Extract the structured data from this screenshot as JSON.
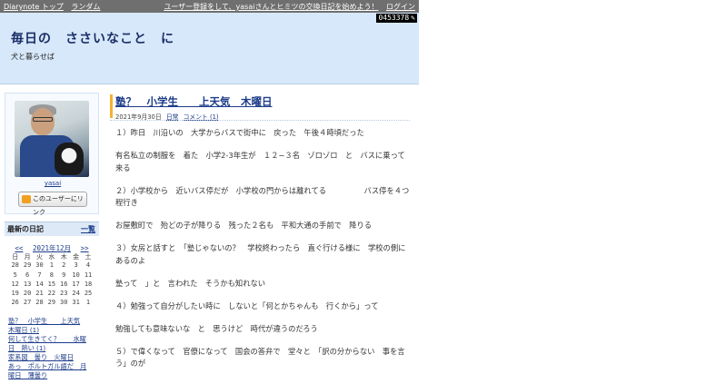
{
  "topbar": {
    "links_left": [
      "Diarynote トップ",
      "ランダム"
    ],
    "signup_text": "ユーザー登録をして、yasaiさんとヒミツの交換日記を始めよう！",
    "login": "ログイン"
  },
  "header": {
    "title": "毎日の　ささいなこと　に",
    "subtitle": "犬と暮らせば",
    "counter": "0453378"
  },
  "sidebar": {
    "profile_name": "yasai",
    "link_button": "このユーザーにリンク",
    "recent_heading": "最新の日記",
    "recent_all": "一覧",
    "calendar": {
      "prev": "<<",
      "month": "2021年12月",
      "next": ">>",
      "weekdays": [
        "日",
        "月",
        "火",
        "水",
        "木",
        "金",
        "土"
      ],
      "weeks": [
        [
          "28",
          "29",
          "30",
          "1",
          "2",
          "3",
          "4"
        ],
        [
          "5",
          "6",
          "7",
          "8",
          "9",
          "10",
          "11"
        ],
        [
          "12",
          "13",
          "14",
          "15",
          "16",
          "17",
          "18"
        ],
        [
          "19",
          "20",
          "21",
          "22",
          "23",
          "24",
          "25"
        ],
        [
          "26",
          "27",
          "28",
          "29",
          "30",
          "31",
          "1"
        ]
      ]
    },
    "recent_entries": [
      "塾？　小学生　　上天気",
      "木曜日 (1)",
      "何して生きてく？　　水曜",
      "日　熱い (1)",
      "家系図　曇り　火曜日",
      "あっ　ポルトガル語だ　月",
      "曜日　薄曇り"
    ]
  },
  "entry": {
    "title": "塾？　小学生　　上天気　木曜日",
    "date": "2021年9月30日",
    "category": "日常",
    "comment": "コメント (1)",
    "paragraphs": [
      "１）昨日　川沿いの　大学からバスで街中に　戻った　午後４時頃だった",
      "有名私立の制服を　着た　小学2-3年生が　１２−３名　ゾロゾロ　と　バスに乗って来る",
      "２）小学校から　近いバス停だが　小学校の門からは離れてる　　　　　バス停を４つ程行き",
      "お屋敷町で　殆どの子が降りる　残った２名も　平和大通の手前で　降りる",
      "３）女房と話すと　「塾じゃないの？　学校終わったら　直ぐ行ける様に　学校の側にあるのよ",
      "塾って　」と　言われた　そうかも知れない",
      "４）勉強って自分がしたい時に　しないと「何とかちゃんも　行くから」って",
      "勉強しても意味ないな　と　思うけど　時代が違うのだろう",
      "５）で偉くなって　官僚になって　国会の答弁で　堂々と　「訳の分からない　事を言う」のが"
    ]
  }
}
